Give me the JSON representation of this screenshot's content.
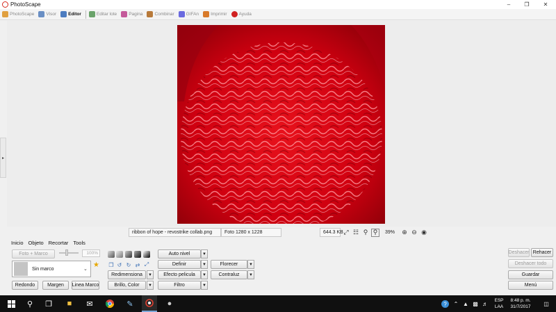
{
  "window": {
    "title": "PhotoScape",
    "minimize_icon": "minimize-icon",
    "maximize_icon": "restore-icon",
    "close_icon": "close-icon"
  },
  "tabs": [
    {
      "label": "PhotoScape",
      "icon": "photoscape-icon",
      "color": "#e0a040"
    },
    {
      "label": "Visor",
      "icon": "viewer-icon",
      "color": "#6a8fc4"
    },
    {
      "label": "Editor",
      "icon": "editor-icon",
      "color": "#4c7cc0"
    },
    {
      "label": "Editar lote",
      "icon": "batch-icon",
      "color": "#6aa36a"
    },
    {
      "label": "Pagina",
      "icon": "page-icon",
      "color": "#c45a9a"
    },
    {
      "label": "Combinar",
      "icon": "combine-icon",
      "color": "#b87a3a"
    },
    {
      "label": "GIFAn",
      "icon": "gif-icon",
      "color": "#6a6adf"
    },
    {
      "label": "Imprimir",
      "icon": "print-icon",
      "color": "#d87a2a"
    },
    {
      "label": "Ayuda",
      "icon": "help-icon",
      "color": "#d02020"
    }
  ],
  "active_tab": "Editor",
  "status": {
    "filename": "ribbon of hope - revostrike collab.png",
    "dimensions": "Foto 1280 x 1228",
    "filesize": "644.3 KB",
    "zoom": "39%"
  },
  "tool_tabs": [
    "Inicio",
    "Objeto",
    "Recortar",
    "Tools"
  ],
  "frame": {
    "button_label": "Foto + Marco",
    "selected": "Sin marco",
    "percent_placeholder": "100%"
  },
  "buttons": {
    "rounded": "Redondo",
    "margin": "Margen",
    "frame_line": "Linea Marco",
    "auto_level": "Auto nivel",
    "sharpen": "Definir",
    "resize": "Redimensiona",
    "film_effect": "Efecto pelicula",
    "brightness": "Brillo, Color",
    "filter": "Filtro",
    "bloom": "Florecer",
    "backlight": "Contraluz",
    "undo": "Deshacer",
    "redo": "Rehacer",
    "undo_all": "Deshacer todo",
    "save": "Guardar",
    "menu": "Menú"
  },
  "taskbar": {
    "apps": [
      "windows-start-icon",
      "search-icon",
      "task-view-icon",
      "file-explorer-icon",
      "mail-icon",
      "chrome-icon",
      "notepad-icon",
      "photoscape-taskbar-icon",
      "paint-icon"
    ],
    "language_line1": "ESP",
    "language_line2": "LAA",
    "time": "8:48 p. m.",
    "date": "31/7/2017"
  },
  "colors": {
    "accent": "#4c7cc0",
    "photo_red": "#c80000",
    "taskbar": "#101010"
  }
}
